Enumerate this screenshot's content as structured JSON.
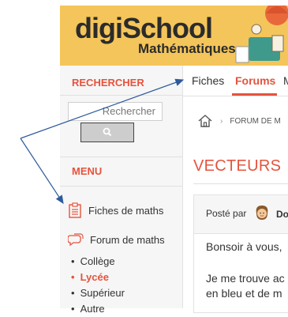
{
  "header": {
    "logo_main": "digiSchool",
    "logo_sub": "Mathématiques"
  },
  "sidebar": {
    "search_title": "RECHERCHER",
    "search_placeholder": "Rechercher",
    "menu_title": "MENU",
    "links": [
      {
        "label": "Fiches de maths",
        "icon": "document-icon"
      },
      {
        "label": "Forum de maths",
        "icon": "chat-bubble-icon"
      }
    ],
    "sub_items": [
      "Collège",
      "Lycée",
      "Supérieur",
      "Autre"
    ]
  },
  "tabs": [
    "Fiches",
    "Forums",
    "M"
  ],
  "breadcrumb": {
    "current": "FORUM DE M"
  },
  "page": {
    "title": "VECTEURS"
  },
  "post": {
    "posted_by": "Posté par",
    "author": "Do",
    "lines": [
      "Bonsoir à vous,",
      "Je me trouve ac",
      "en bleu et de m"
    ]
  },
  "colors": {
    "accent": "#e5533d",
    "banner": "#f4c55a",
    "arrow": "#2d5a9c"
  }
}
